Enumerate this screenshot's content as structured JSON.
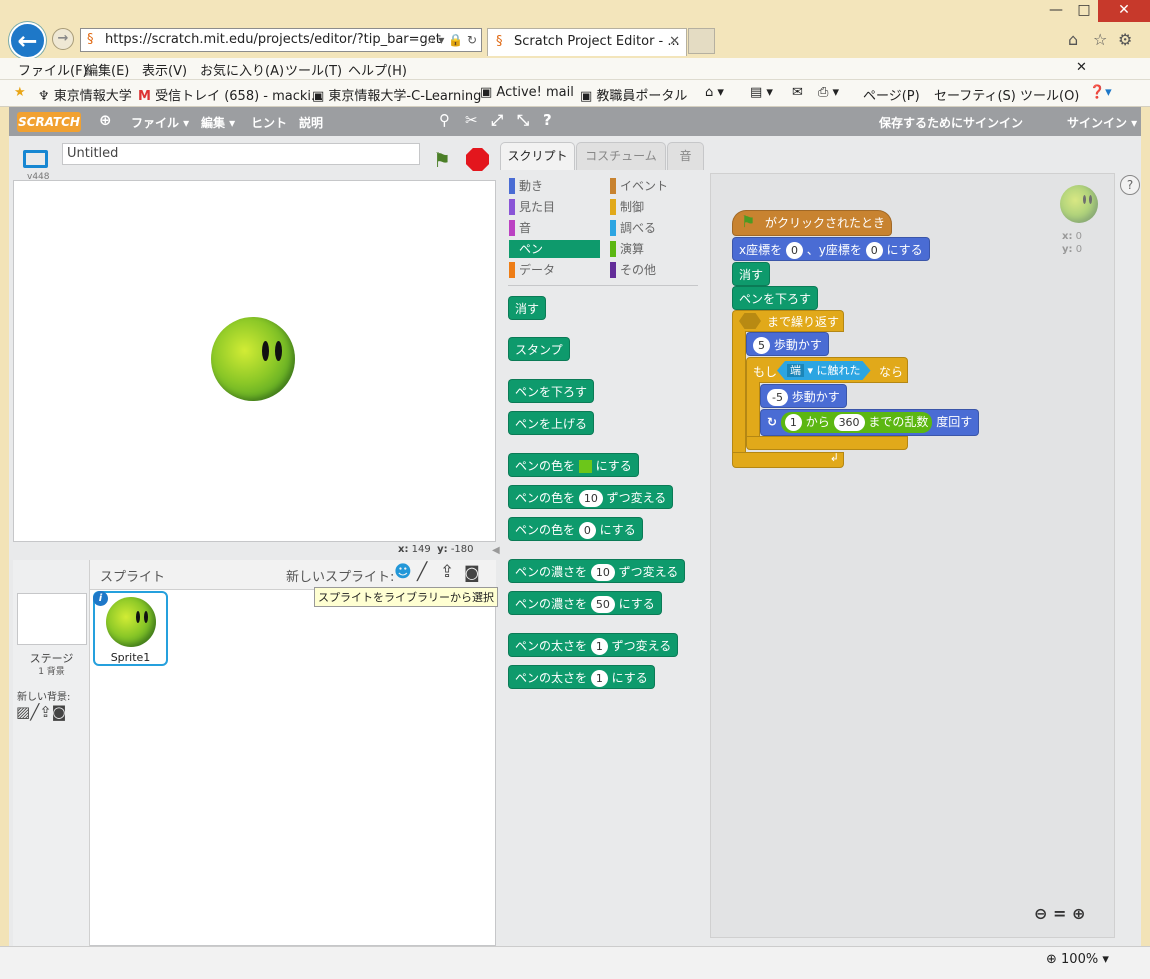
{
  "browser": {
    "address": "https://scratch.mit.edu/projects/editor/?tip_bar=get",
    "tab_title": "Scratch Project Editor - ...",
    "win_min": "—",
    "win_max": "□",
    "win_close": "✕",
    "menus": [
      "ファイル(F)",
      "編集(E)",
      "表示(V)",
      "お気に入り(A)",
      "ツール(T)",
      "ヘルプ(H)"
    ],
    "favorites": [
      "東京情報大学",
      "受信トレイ (658) - macki...",
      "東京情報大学-C-Learning",
      "Active! mail",
      "教職員ポータル"
    ],
    "toolbar": [
      "ページ(P)",
      "セーフティ(S)",
      "ツール(O)"
    ],
    "zoom": "100%"
  },
  "scratch": {
    "logo": "SCRATCH",
    "menu": [
      "ファイル ▾",
      "編集 ▾",
      "ヒント",
      "説明"
    ],
    "save_signin": "保存するためにサインイン",
    "signin": "サインイン ▾",
    "project_title": "Untitled",
    "version": "v448",
    "mouse_x_label": "x:",
    "mouse_x": "149",
    "mouse_y_label": "y:",
    "mouse_y": "-180",
    "sprites_label": "スプライト",
    "new_sprite_label": "新しいスプライト:",
    "tooltip": "スプライトをライブラリーから選択",
    "stage_label": "ステージ",
    "stage_backdrops": "1 背景",
    "new_backdrop_label": "新しい背景:",
    "sprite_name": "Sprite1",
    "tabs": [
      "スクリプト",
      "コスチューム",
      "音"
    ],
    "categories_left": [
      "動き",
      "見た目",
      "音",
      "ペン",
      "データ"
    ],
    "categories_right": [
      "イベント",
      "制御",
      "調べる",
      "演算",
      "その他"
    ],
    "palette": {
      "clear": "消す",
      "stamp": "スタンプ",
      "pen_down": "ペンを下ろす",
      "pen_up": "ペンを上げる",
      "set_color_a": "ペンの色を",
      "set_color_b": "にする",
      "change_color_a": "ペンの色を",
      "change_color_val": "10",
      "change_color_b": "ずつ変える",
      "set_color_num_a": "ペンの色を",
      "set_color_num_val": "0",
      "set_color_num_b": "にする",
      "change_shade_a": "ペンの濃さを",
      "change_shade_val": "10",
      "change_shade_b": "ずつ変える",
      "set_shade_a": "ペンの濃さを",
      "set_shade_val": "50",
      "set_shade_b": "にする",
      "change_size_a": "ペンの太さを",
      "change_size_val": "1",
      "change_size_b": "ずつ変える",
      "set_size_a": "ペンの太さを",
      "set_size_val": "1",
      "set_size_b": "にする"
    },
    "script": {
      "hat": "がクリックされたとき",
      "goto_a": "x座標を",
      "goto_x": "0",
      "goto_b": "、y座標を",
      "goto_y": "0",
      "goto_c": "にする",
      "clear": "消す",
      "pen_down": "ペンを下ろす",
      "repeat_until": "まで繰り返す",
      "move_val": "5",
      "move": "歩動かす",
      "if": "もし",
      "touching_val": "端",
      "touching": "に触れた",
      "then": "なら",
      "move_back_val": "-5",
      "move_back": "歩動かす",
      "random_from": "1",
      "random_a": "から",
      "random_to": "360",
      "random_b": "までの乱数",
      "turn": "度回す"
    },
    "sprite_x_label": "x:",
    "sprite_x": "0",
    "sprite_y_label": "y:",
    "sprite_y": "0"
  }
}
